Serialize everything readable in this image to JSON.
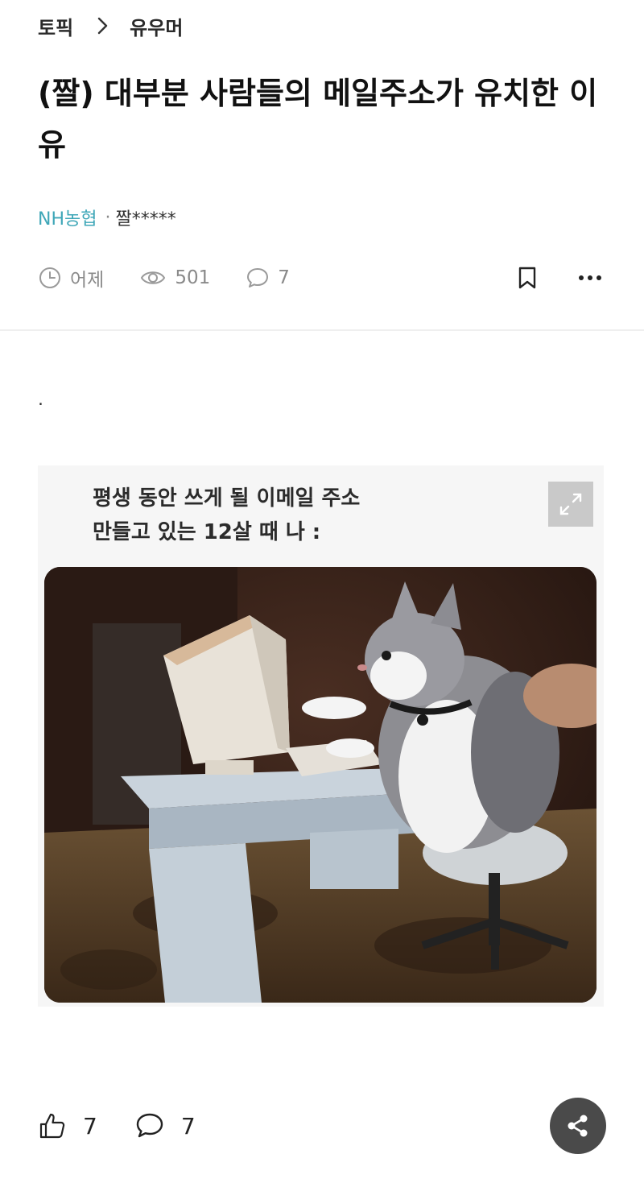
{
  "breadcrumb": {
    "topic": "토픽",
    "category": "유우머"
  },
  "post": {
    "title": "(짤) 대부분 사람들의 메일주소가 유치한 이유",
    "company": "NH농협",
    "separator": "·",
    "author": "짤*****",
    "time": "어제",
    "views": "501",
    "comments": "7",
    "body_text": "."
  },
  "image": {
    "caption_line1": "평생 동안 쓰게 될 이메일 주소",
    "caption_line2": "만들고 있는 12살 때 나 :",
    "description": "cat typing on an old computer"
  },
  "footer": {
    "likes": "7",
    "comments": "7"
  },
  "icons": {
    "chevron": "chevron-right-icon",
    "clock": "clock-icon",
    "eye": "eye-icon",
    "comment": "comment-icon",
    "bookmark": "bookmark-icon",
    "more": "more-icon",
    "expand": "expand-icon",
    "like": "thumbs-up-icon",
    "share": "share-icon"
  },
  "colors": {
    "company": "#3fa7b8",
    "share_button": "#4a4a4a"
  }
}
